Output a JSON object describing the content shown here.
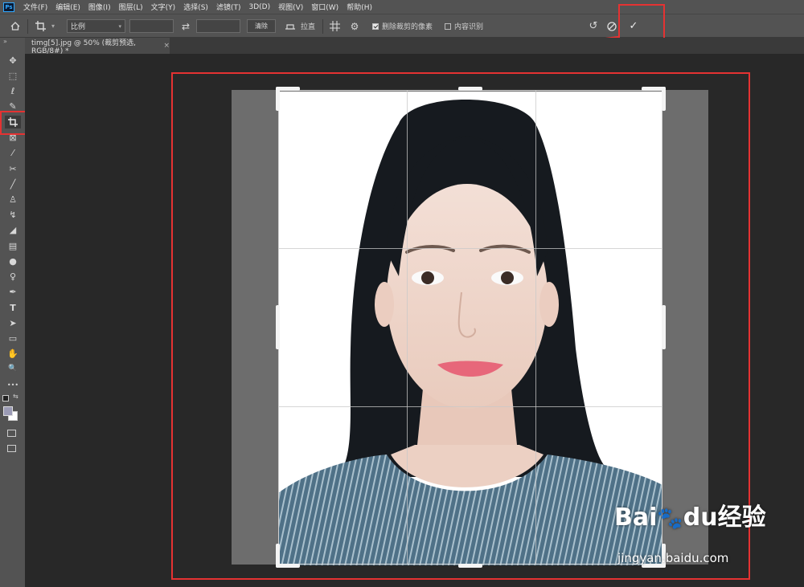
{
  "menubar": {
    "logo": "Ps",
    "items": [
      "文件(F)",
      "编辑(E)",
      "图像(I)",
      "图层(L)",
      "文字(Y)",
      "选择(S)",
      "滤镜(T)",
      "3D(D)",
      "视图(V)",
      "窗口(W)",
      "帮助(H)"
    ]
  },
  "options": {
    "ratio_select": "比例",
    "width_value": "",
    "height_value": "",
    "clear_label": "清除",
    "straighten_label": "拉直",
    "delete_cropped_label": "删除裁剪的像素",
    "delete_cropped_checked": true,
    "content_aware_label": "内容识别",
    "content_aware_checked": false
  },
  "document": {
    "tab_title": "timg[5].jpg @ 50% (裁剪预选, RGB/8#) *",
    "close_glyph": "×"
  },
  "tools": [
    {
      "name": "move-tool",
      "glyph": "✥"
    },
    {
      "name": "marquee-tool",
      "glyph": "⬚"
    },
    {
      "name": "lasso-tool",
      "glyph": "ℓ"
    },
    {
      "name": "quick-select-tool",
      "glyph": "✎"
    },
    {
      "name": "crop-tool",
      "glyph": "⌗"
    },
    {
      "name": "frame-tool",
      "glyph": "⊠"
    },
    {
      "name": "eyedropper-tool",
      "glyph": "⁄"
    },
    {
      "name": "healing-tool",
      "glyph": "✂"
    },
    {
      "name": "brush-tool",
      "glyph": "╱"
    },
    {
      "name": "stamp-tool",
      "glyph": "♙"
    },
    {
      "name": "history-brush-tool",
      "glyph": "↯"
    },
    {
      "name": "eraser-tool",
      "glyph": "◢"
    },
    {
      "name": "gradient-tool",
      "glyph": "▤"
    },
    {
      "name": "blur-tool",
      "glyph": "●"
    },
    {
      "name": "dodge-tool",
      "glyph": "♀"
    },
    {
      "name": "pen-tool",
      "glyph": "✒"
    },
    {
      "name": "type-tool",
      "glyph": "T"
    },
    {
      "name": "path-select-tool",
      "glyph": "➤"
    },
    {
      "name": "rectangle-tool",
      "glyph": "▭"
    },
    {
      "name": "hand-tool",
      "glyph": "✋"
    },
    {
      "name": "zoom-tool",
      "glyph": "🔍"
    },
    {
      "name": "more-tools",
      "glyph": "•••"
    }
  ],
  "watermark": {
    "brand": "Bai",
    "brand_mid": "du",
    "brand_suffix": "经验",
    "url": "jingyan.baidu.com"
  },
  "colors": {
    "highlight": "#e53232",
    "panel": "#535353",
    "canvas": "#282828"
  }
}
